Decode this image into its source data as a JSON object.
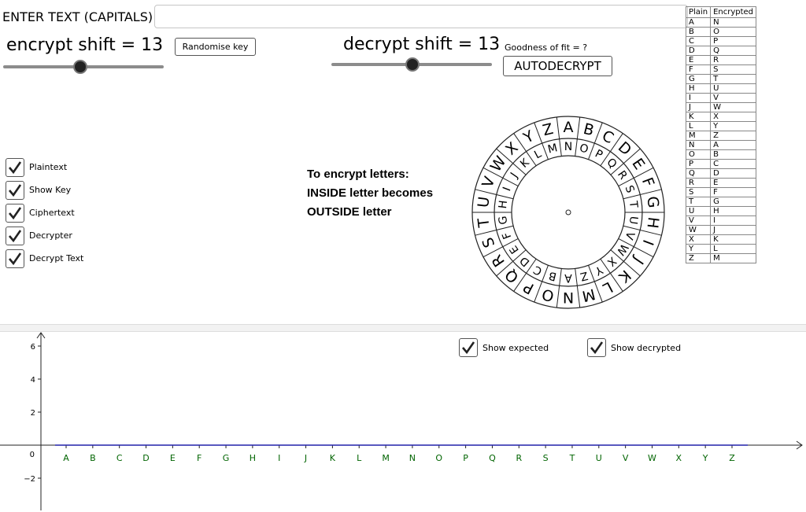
{
  "input": {
    "prompt": "ENTER TEXT (CAPITALS)",
    "value": ""
  },
  "encrypt": {
    "label": "encrypt shift = 13",
    "shift": 13,
    "min": 0,
    "max": 25
  },
  "decrypt": {
    "label": "decrypt shift = 13",
    "shift": 13,
    "min": 0,
    "max": 25
  },
  "buttons": {
    "randomise": "Randomise key",
    "autodecrypt": "AUTODECRYPT"
  },
  "fit_label": "Goodness of fit = ?",
  "checkboxes": [
    {
      "label": "Plaintext",
      "checked": true
    },
    {
      "label": "Show Key",
      "checked": true
    },
    {
      "label": "Ciphertext",
      "checked": true
    },
    {
      "label": "Decrypter",
      "checked": true
    },
    {
      "label": "Decrypt Text",
      "checked": true
    }
  ],
  "instructions": {
    "line1": "To encrypt letters:",
    "line2": "INSIDE letter becomes",
    "line3": "OUTSIDE letter"
  },
  "wheel": {
    "outer": [
      "A",
      "B",
      "C",
      "D",
      "E",
      "F",
      "G",
      "H",
      "I",
      "J",
      "K",
      "L",
      "M",
      "N",
      "O",
      "P",
      "Q",
      "R",
      "S",
      "T",
      "U",
      "V",
      "W",
      "X",
      "Y",
      "Z"
    ],
    "inner": [
      "N",
      "O",
      "P",
      "Q",
      "R",
      "S",
      "T",
      "U",
      "V",
      "W",
      "X",
      "Y",
      "Z",
      "A",
      "B",
      "C",
      "D",
      "E",
      "F",
      "G",
      "H",
      "I",
      "J",
      "K",
      "L",
      "M"
    ]
  },
  "table": {
    "headers": [
      "Plain",
      "Encrypted"
    ],
    "rows": [
      [
        "A",
        "N"
      ],
      [
        "B",
        "O"
      ],
      [
        "C",
        "P"
      ],
      [
        "D",
        "Q"
      ],
      [
        "E",
        "R"
      ],
      [
        "F",
        "S"
      ],
      [
        "G",
        "T"
      ],
      [
        "H",
        "U"
      ],
      [
        "I",
        "V"
      ],
      [
        "J",
        "W"
      ],
      [
        "K",
        "X"
      ],
      [
        "L",
        "Y"
      ],
      [
        "M",
        "Z"
      ],
      [
        "N",
        "A"
      ],
      [
        "O",
        "B"
      ],
      [
        "P",
        "C"
      ],
      [
        "Q",
        "D"
      ],
      [
        "R",
        "E"
      ],
      [
        "S",
        "F"
      ],
      [
        "T",
        "G"
      ],
      [
        "U",
        "H"
      ],
      [
        "V",
        "I"
      ],
      [
        "W",
        "J"
      ],
      [
        "X",
        "K"
      ],
      [
        "Y",
        "L"
      ],
      [
        "Z",
        "M"
      ]
    ]
  },
  "graph_toggles": [
    {
      "label": "Show expected",
      "checked": true
    },
    {
      "label": "Show decrypted",
      "checked": true
    }
  ],
  "chart_data": {
    "type": "line",
    "x": [
      "A",
      "B",
      "C",
      "D",
      "E",
      "F",
      "G",
      "H",
      "I",
      "J",
      "K",
      "L",
      "M",
      "N",
      "O",
      "P",
      "Q",
      "R",
      "S",
      "T",
      "U",
      "V",
      "W",
      "X",
      "Y",
      "Z"
    ],
    "series": [
      {
        "values": [
          0,
          0,
          0,
          0,
          0,
          0,
          0,
          0,
          0,
          0,
          0,
          0,
          0,
          0,
          0,
          0,
          0,
          0,
          0,
          0,
          0,
          0,
          0,
          0,
          0,
          0
        ],
        "color": "#2222aa"
      }
    ],
    "ytick_labels": [
      "6",
      "4",
      "2",
      "0",
      "−2"
    ],
    "yticks": [
      6,
      4,
      2,
      0,
      -2
    ],
    "ylim": [
      -3.2,
      6.5
    ],
    "label_color": "#006400"
  }
}
